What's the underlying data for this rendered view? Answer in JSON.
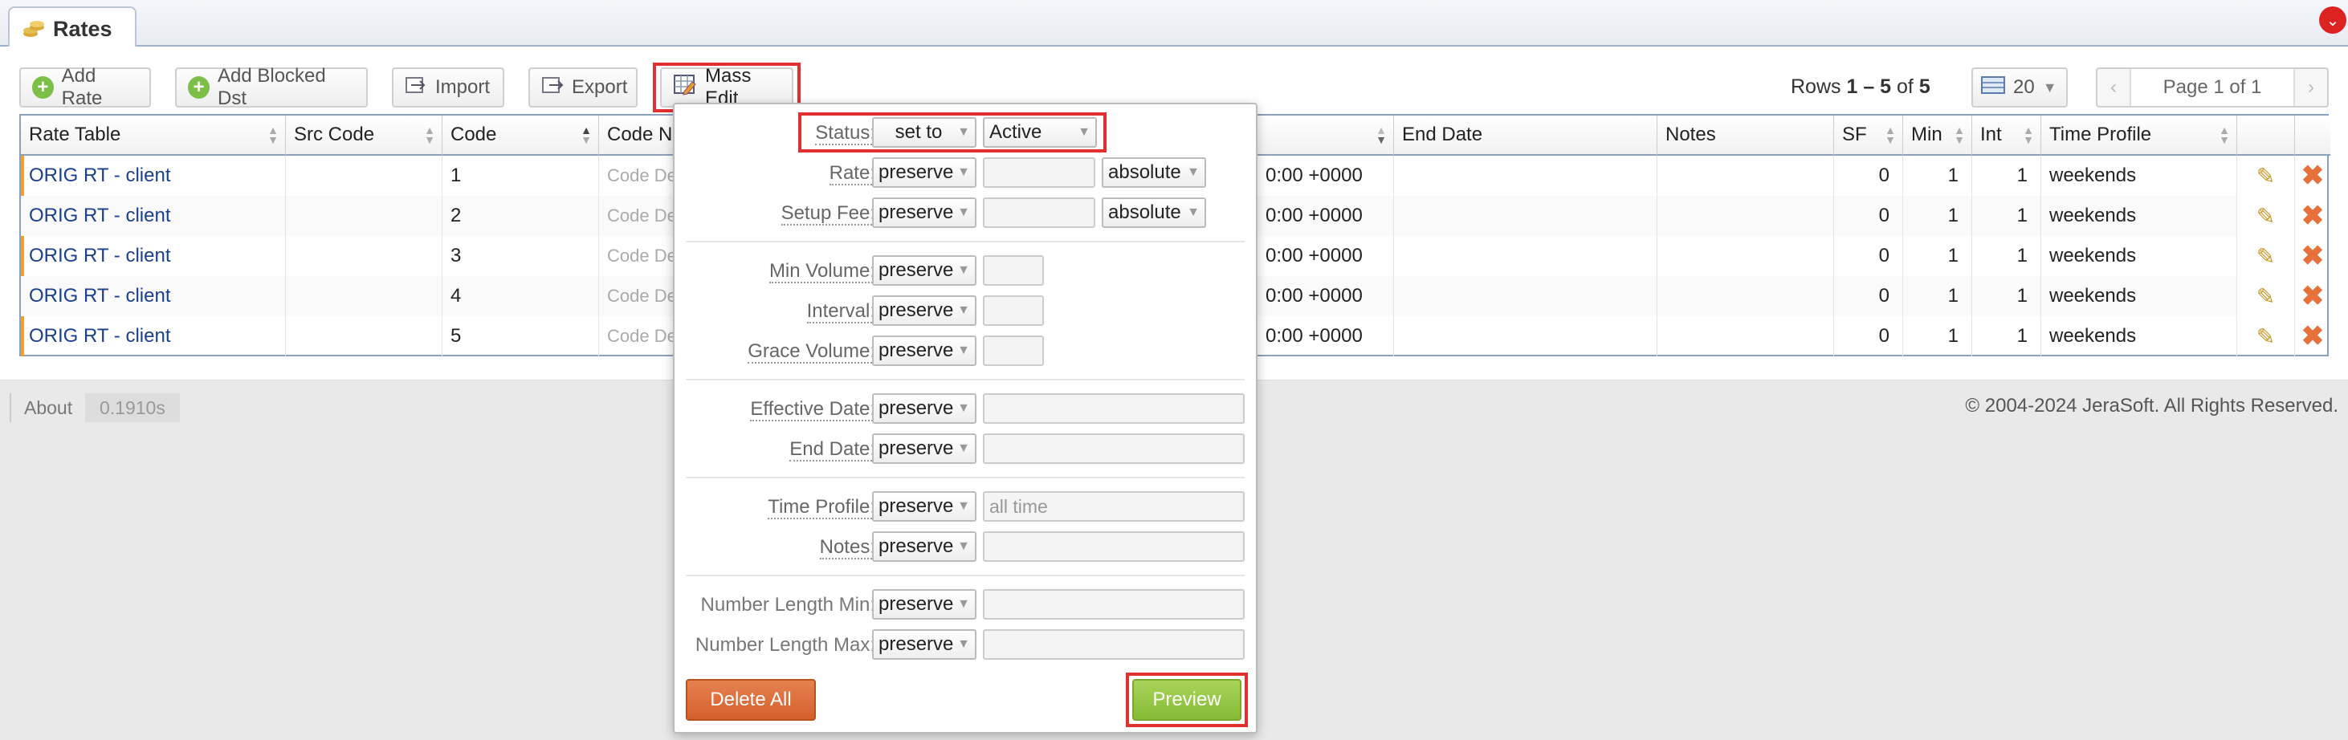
{
  "tab": {
    "title": "Rates",
    "icon": "coins-icon"
  },
  "toolbar": {
    "add_rate": "Add Rate",
    "add_blocked": "Add Blocked Dst",
    "import": "Import",
    "export": "Export",
    "mass_edit": "Mass Edit"
  },
  "pagination": {
    "rows_prefix": "Rows",
    "rows_range": "1 – 5",
    "rows_of": "of",
    "rows_total": "5",
    "per_page": "20",
    "page_label": "Page 1 of 1",
    "prev": "‹",
    "next": "›"
  },
  "table": {
    "headers": [
      "Rate Table",
      "Src Code",
      "Code",
      "Code Na",
      "End Date",
      "Notes",
      "SF",
      "Min",
      "Int",
      "Time Profile"
    ],
    "rows": [
      {
        "rate_table": "ORIG RT - client",
        "code": "1",
        "code_name": "Code Des",
        "eff_date": "0:00 +0000",
        "sf": "0",
        "min": "1",
        "int": "1",
        "time_profile": "weekends"
      },
      {
        "rate_table": "ORIG RT - client",
        "code": "2",
        "code_name": "Code Des",
        "eff_date": "0:00 +0000",
        "sf": "0",
        "min": "1",
        "int": "1",
        "time_profile": "weekends"
      },
      {
        "rate_table": "ORIG RT - client",
        "code": "3",
        "code_name": "Code Des",
        "eff_date": "0:00 +0000",
        "sf": "0",
        "min": "1",
        "int": "1",
        "time_profile": "weekends"
      },
      {
        "rate_table": "ORIG RT - client",
        "code": "4",
        "code_name": "Code Des",
        "eff_date": "0:00 +0000",
        "sf": "0",
        "min": "1",
        "int": "1",
        "time_profile": "weekends"
      },
      {
        "rate_table": "ORIG RT - client",
        "code": "5",
        "code_name": "Code Des",
        "eff_date": "0:00 +0000",
        "sf": "0",
        "min": "1",
        "int": "1",
        "time_profile": "weekends"
      }
    ]
  },
  "footer": {
    "about": "About",
    "timing": "0.1910s",
    "copyright": "© 2004-2024 JeraSoft. All Rights Reserved."
  },
  "mass_edit": {
    "status": {
      "label": "Status:",
      "mode": "set to",
      "value": "Active"
    },
    "rate": {
      "label": "Rate:",
      "mode": "preserve",
      "value": "",
      "type": "absolute"
    },
    "setup_fee": {
      "label": "Setup Fee:",
      "mode": "preserve",
      "value": "",
      "type": "absolute"
    },
    "min_volume": {
      "label": "Min Volume:",
      "mode": "preserve",
      "value": ""
    },
    "interval": {
      "label": "Interval:",
      "mode": "preserve",
      "value": ""
    },
    "grace_volume": {
      "label": "Grace Volume:",
      "mode": "preserve",
      "value": ""
    },
    "effective_date": {
      "label": "Effective Date:",
      "mode": "preserve",
      "value": ""
    },
    "end_date": {
      "label": "End Date:",
      "mode": "preserve",
      "value": ""
    },
    "time_profile": {
      "label": "Time Profile:",
      "mode": "preserve",
      "placeholder": "all time"
    },
    "notes": {
      "label": "Notes:",
      "mode": "preserve",
      "value": ""
    },
    "num_len_min": {
      "label": "Number Length Min:",
      "mode": "preserve",
      "value": ""
    },
    "num_len_max": {
      "label": "Number Length Max:",
      "mode": "preserve",
      "value": ""
    },
    "delete_all": "Delete All",
    "preview": "Preview"
  },
  "colors": {
    "accent_red": "#e03030",
    "preview_green": "#86bb36",
    "delete_orange": "#d4602c",
    "link_blue": "#1a3f8f"
  }
}
